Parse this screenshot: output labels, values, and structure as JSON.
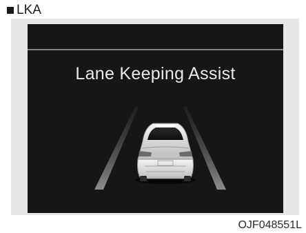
{
  "section": {
    "title": "LKA"
  },
  "display": {
    "message": "Lane Keeping Assist",
    "icon": "lane-keeping-car-icon",
    "colors": {
      "screen_bg": "#161616",
      "frame_bg": "#e7e7e7",
      "text": "#e9e9e9"
    }
  },
  "figure": {
    "code": "OJF048551L"
  }
}
